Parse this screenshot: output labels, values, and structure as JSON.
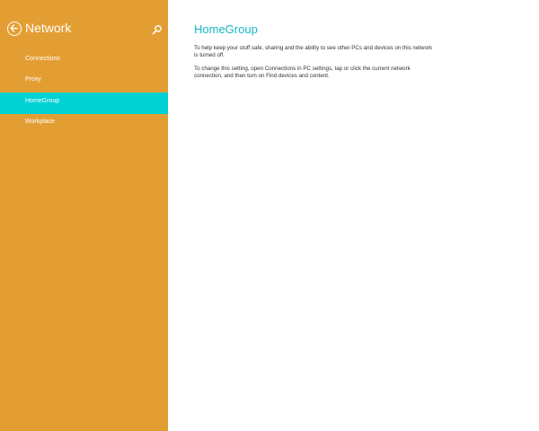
{
  "sidebar": {
    "title": "Network",
    "items": [
      {
        "label": "Connections",
        "selected": false
      },
      {
        "label": "Proxy",
        "selected": false
      },
      {
        "label": "HomeGroup",
        "selected": true
      },
      {
        "label": "Workplace",
        "selected": false
      }
    ],
    "back_icon": "back-arrow-circle-icon",
    "search_icon": "search-icon"
  },
  "main": {
    "title": "HomeGroup",
    "paragraph1": "To help keep your stuff safe, sharing and the ability to see other PCs and devices on this network is turned off.",
    "paragraph2": "To change this setting, open Connections in PC settings, tap or click the current network connection, and then turn on Find devices and content."
  },
  "colors": {
    "sidebar_bg": "#e39e33",
    "selected_bg": "#00d2d4",
    "title_accent": "#16b6c6",
    "content_bg": "#ffffff"
  }
}
